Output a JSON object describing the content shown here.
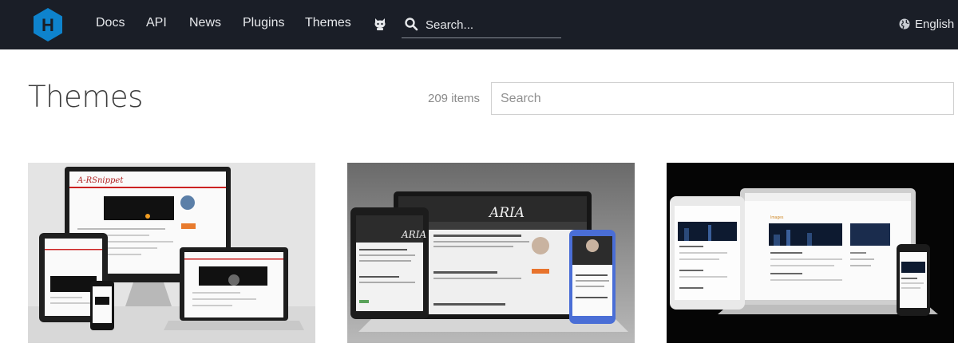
{
  "header": {
    "logo_letter": "H",
    "nav": [
      {
        "label": "Docs"
      },
      {
        "label": "API"
      },
      {
        "label": "News"
      },
      {
        "label": "Plugins"
      },
      {
        "label": "Themes"
      }
    ],
    "github_icon": "github-icon",
    "search_placeholder": "Search...",
    "language": "English",
    "colors": {
      "bar": "#1a1e27",
      "logo": "#0e83cd",
      "text": "#e6e8eb"
    }
  },
  "main": {
    "title": "Themes",
    "count": "209 items",
    "search_placeholder": "Search",
    "themes": [
      {
        "screen_text": "A-RSnippet",
        "preview": "light-gray-devices"
      },
      {
        "screen_text": "ARIA",
        "preview": "dark-devices"
      },
      {
        "screen_text": "Images",
        "preview": "black-background-devices"
      }
    ]
  }
}
